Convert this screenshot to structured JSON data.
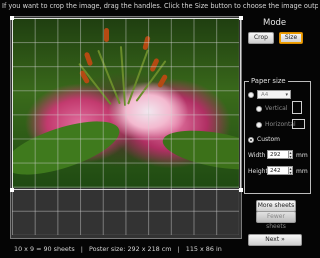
{
  "instructions": "If you want to crop the image, drag the handles. Click the Size button to choose the image output size.",
  "mode": {
    "title": "Mode",
    "crop_label": "Crop",
    "size_label": "Size",
    "active": "Size"
  },
  "paper_size": {
    "title": "Paper size",
    "preset_value": "A4",
    "vertical_label": "Vertical",
    "horizontal_label": "Horizontal",
    "custom_label": "Custom",
    "selected": "Custom",
    "width_label": "Width",
    "width_value": "292",
    "height_label": "Height",
    "height_value": "242",
    "unit": "mm"
  },
  "sheets": {
    "more_label": "More sheets",
    "fewer_label": "Fewer sheets"
  },
  "next_label": "Next »",
  "status": {
    "sheets": "10 x 9 = 90 sheets",
    "sep1": "|",
    "poster_size": "Poster size: 292 x 218 cm",
    "sep2": "|",
    "inches": "115 x 86 in"
  },
  "colors": {
    "background": "#050505",
    "active_border": "#f0a000"
  }
}
